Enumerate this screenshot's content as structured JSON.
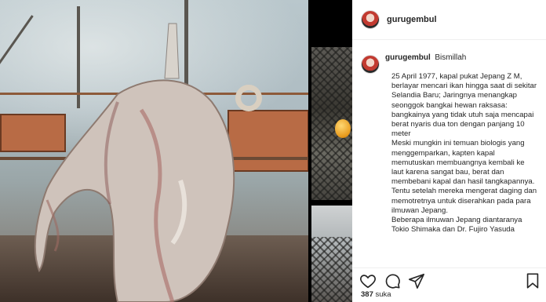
{
  "post": {
    "username": "gurugembul",
    "caption_header_user": "gurugembul",
    "caption_header_text": "Bismillah",
    "caption_paragraphs": [
      "25 April 1977, kapal pukat Jepang Z M, berlayar mencari ikan hingga saat di sekitar Selandia Baru; Jaringnya menangkap seonggok bangkai hewan raksasa: bangkainya yang tidak utuh saja mencapai berat nyaris dua ton dengan panjang 10 meter",
      "Meski mungkin ini temuan biologis yang menggemparkan, kapten kapal memutuskan membuangnya kembali ke laut karena sangat bau, berat dan membebani kapal dan hasil tangkapannya. Tentu setelah mereka mengerat daging dan memotretnya untuk diserahkan pada para ilmuwan Jepang.",
      "Beberapa ilmuwan Jepang diantaranya Tokio Shimaka dan Dr. Fujiro Yasuda"
    ],
    "likes_count": "387",
    "likes_label": "suka"
  },
  "icons": {
    "more": "more-options-icon",
    "like": "heart-icon",
    "comment": "comment-icon",
    "share": "share-icon",
    "save": "bookmark-icon"
  },
  "colors": {
    "text": "#262626",
    "border": "#efefef",
    "background": "#ffffff"
  }
}
